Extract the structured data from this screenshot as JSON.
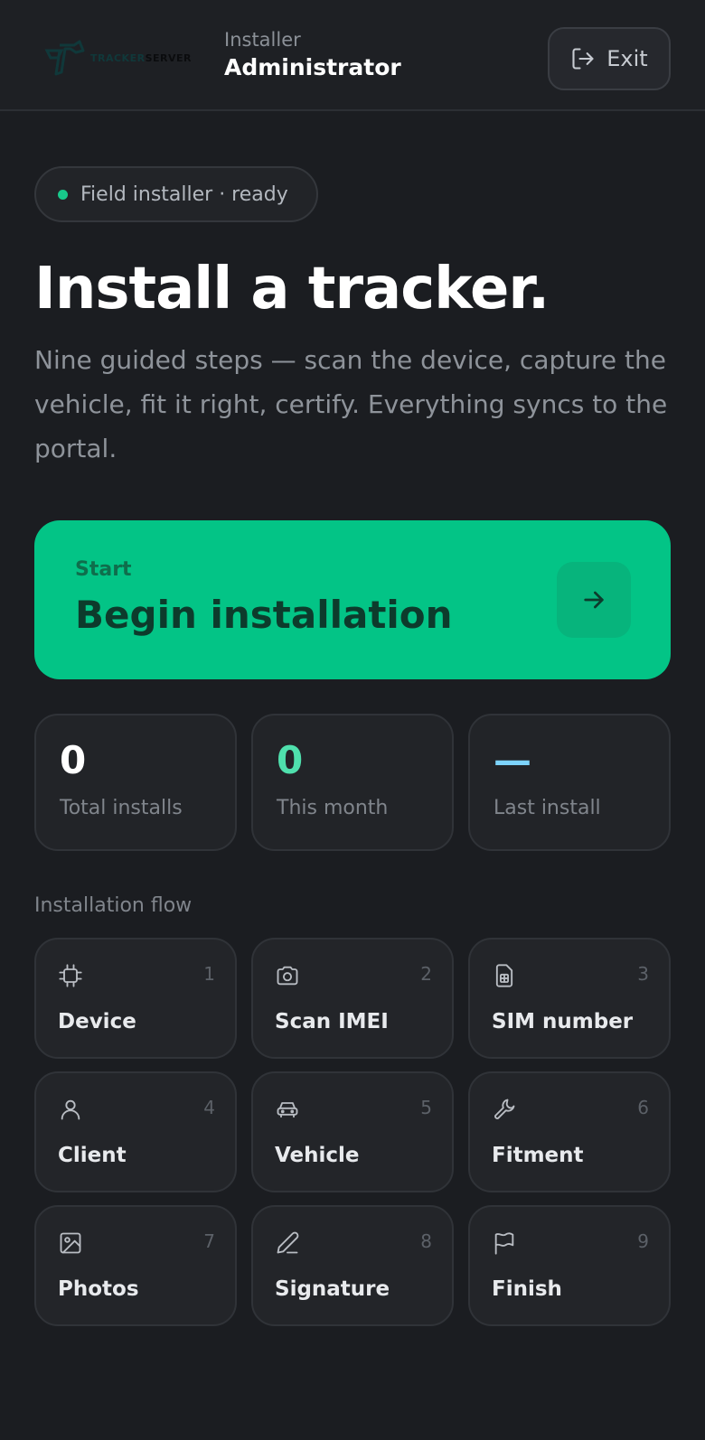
{
  "header": {
    "logo_text_part1": "TRACKER",
    "logo_text_part2": "SERVER",
    "role_label": "Installer",
    "user_name": "Administrator",
    "exit_label": "Exit"
  },
  "status": {
    "text": "Field installer · ready",
    "dot_color": "#18c98b"
  },
  "hero": {
    "title": "Install a tracker.",
    "subtitle": "Nine guided steps — scan the device, capture the vehicle, fit it right, certify. Everything syncs to the portal."
  },
  "cta": {
    "kicker": "Start",
    "title": "Begin installation",
    "color": "#03c486"
  },
  "stats": [
    {
      "value": "0",
      "label": "Total installs",
      "color": "#ffffff"
    },
    {
      "value": "0",
      "label": "This month",
      "color": "#4fe0ad"
    },
    {
      "value": "—",
      "label": "Last install",
      "color": "#7dd3fc"
    }
  ],
  "flow": {
    "label": "Installation flow",
    "steps": [
      {
        "num": "1",
        "label": "Device",
        "icon": "chip-icon"
      },
      {
        "num": "2",
        "label": "Scan IMEI",
        "icon": "camera-icon"
      },
      {
        "num": "3",
        "label": "SIM number",
        "icon": "sim-card-icon"
      },
      {
        "num": "4",
        "label": "Client",
        "icon": "user-icon"
      },
      {
        "num": "5",
        "label": "Vehicle",
        "icon": "car-icon"
      },
      {
        "num": "6",
        "label": "Fitment",
        "icon": "wrench-icon"
      },
      {
        "num": "7",
        "label": "Photos",
        "icon": "image-icon"
      },
      {
        "num": "8",
        "label": "Signature",
        "icon": "pen-icon"
      },
      {
        "num": "9",
        "label": "Finish",
        "icon": "flag-icon"
      }
    ]
  }
}
